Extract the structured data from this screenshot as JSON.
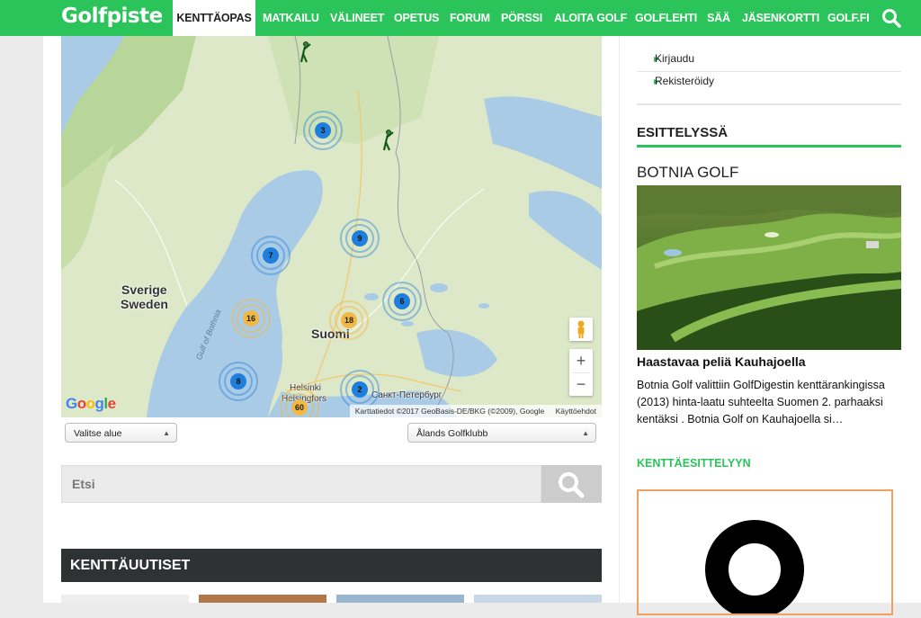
{
  "brand": {
    "logo": "Golfpiste",
    "accent": "#2bc45a"
  },
  "nav": {
    "items": [
      "KENTTÄOPAS",
      "MATKAILU",
      "VÄLINEET",
      "OPETUS",
      "FORUM",
      "PÖRSSI",
      "ALOITA GOLF",
      "GOLFLEHTI",
      "SÄÄ",
      "JÄSENKORTTI",
      "GOLF.FI"
    ],
    "active": "KENTTÄOPAS",
    "search_icon": "search-icon"
  },
  "map": {
    "clusters": [
      {
        "count": "3",
        "color": "blue"
      },
      {
        "count": "7",
        "color": "blue"
      },
      {
        "count": "9",
        "color": "blue"
      },
      {
        "count": "6",
        "color": "blue"
      },
      {
        "count": "16",
        "color": "orange"
      },
      {
        "count": "18",
        "color": "orange"
      },
      {
        "count": "8",
        "color": "blue"
      },
      {
        "count": "2",
        "color": "blue"
      },
      {
        "count": "60",
        "color": "orange"
      }
    ],
    "labels": {
      "sverige": "Sverige",
      "sweden": "Sweden",
      "suomi": "Suomi",
      "helsinki": "Helsinki",
      "helsingfors": "Helsingfors",
      "spb": "Санкт-Петербург",
      "gulf": "Gulf of Bothnia"
    },
    "google": "Google",
    "attribution": "Karttatiedot ©2017 GeoBasis-DE/BKG (©2009), Google",
    "terms": "Käyttöehdot",
    "zoom_in": "+",
    "zoom_out": "−"
  },
  "filters": {
    "region": "Valitse alue",
    "club": "Ålands Golfklubb"
  },
  "search": {
    "placeholder": "Etsi"
  },
  "news": {
    "title": "KENTTÄUUTISET"
  },
  "sidebar": {
    "links": [
      "Kirjaudu",
      "Rekisteröidy"
    ],
    "section_title": "ESITTELYSSÄ",
    "feature_title": "BOTNIA GOLF",
    "headline": "Haastavaa peliä Kauhajoella",
    "body": "Botnia Golf valittiin GolfDigestin kenttärankingissa (2013) hinta-laatu suhteelta Suomen 2. parhaaksi kentäksi . Botnia Golf on Kauhajoella si…",
    "more": "KENTTÄESITTELYYN"
  }
}
